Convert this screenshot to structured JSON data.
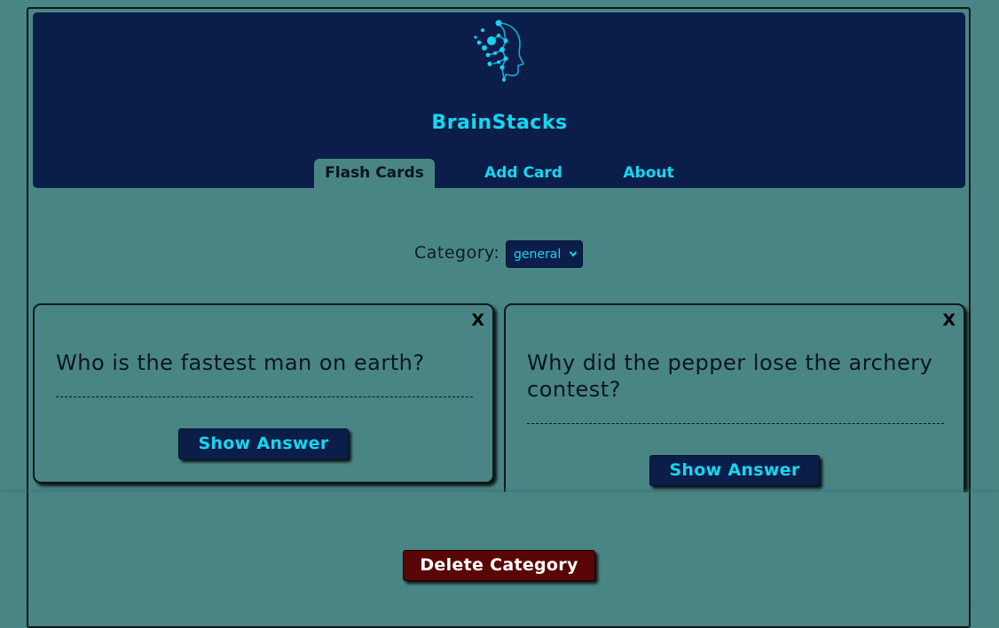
{
  "app": {
    "title": "BrainStacks",
    "logo_icon": "brain-head-icon"
  },
  "nav": {
    "items": [
      {
        "label": "Flash Cards",
        "active": true
      },
      {
        "label": "Add Card",
        "active": false
      },
      {
        "label": "About",
        "active": false
      }
    ]
  },
  "category": {
    "label": "Category:",
    "selected": "general"
  },
  "cards": [
    {
      "question": "Who is the fastest man on earth?",
      "close_label": "X",
      "button_label": "Show Answer"
    },
    {
      "question_line1": "Why did the pepper lose the archery",
      "question_line2": "contest?",
      "close_label": "X",
      "button_label": "Show Answer"
    }
  ],
  "footer": {
    "delete_label": "Delete Category"
  },
  "colors": {
    "background": "#4a8585",
    "header": "#0b1e4a",
    "accent": "#14d7ee",
    "danger": "#5a0606"
  }
}
